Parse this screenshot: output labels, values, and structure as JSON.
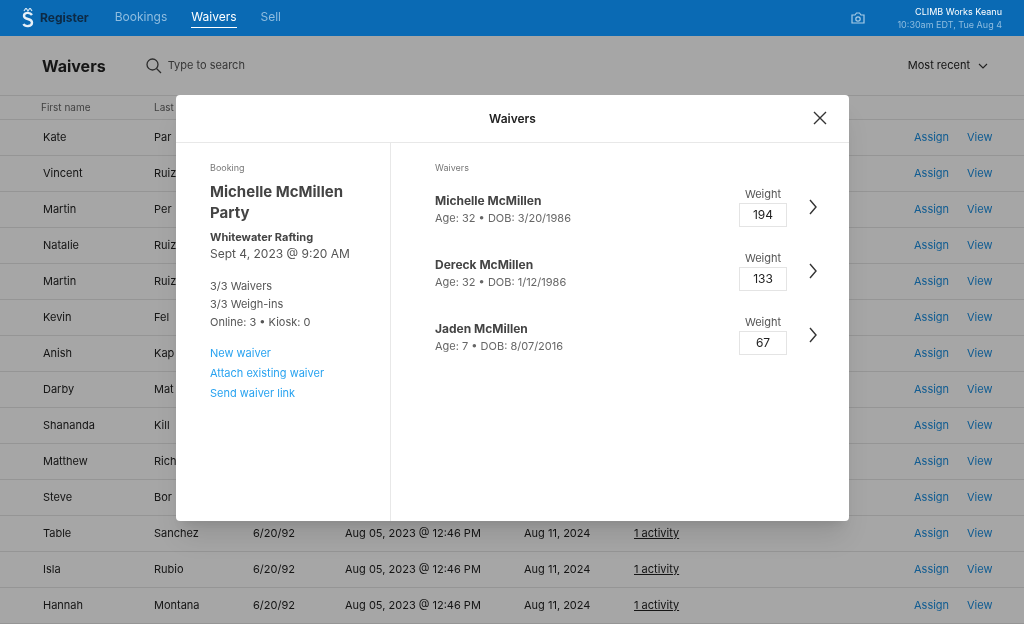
{
  "topbar": {
    "brand": "Register",
    "nav": [
      {
        "label": "Bookings",
        "selected": false
      },
      {
        "label": "Waivers",
        "selected": true
      },
      {
        "label": "Sell",
        "selected": false
      }
    ],
    "account_name": "CLIMB Works Keanu",
    "account_time": "10:30am EDT, Tue Aug 4"
  },
  "page": {
    "title": "Waivers",
    "search_placeholder": "Type to search",
    "sort_label": "Most recent"
  },
  "table": {
    "columns": [
      "First name",
      "Last"
    ],
    "rows": [
      {
        "first": "Kate",
        "last": "Par",
        "actions": [
          "Assign",
          "View"
        ]
      },
      {
        "first": "Vincent",
        "last": "Ruiz",
        "actions": [
          "Assign",
          "View"
        ]
      },
      {
        "first": "Martin",
        "last": "Per",
        "actions": [
          "Assign",
          "View"
        ]
      },
      {
        "first": "Natalie",
        "last": "Ruiz",
        "actions": [
          "Assign",
          "View"
        ]
      },
      {
        "first": "Martin",
        "last": "Ruiz",
        "actions": [
          "Assign",
          "View"
        ]
      },
      {
        "first": "Kevin",
        "last": "Fel",
        "actions": [
          "Assign",
          "View"
        ]
      },
      {
        "first": "Anish",
        "last": "Kap",
        "actions": [
          "Assign",
          "View"
        ]
      },
      {
        "first": "Darby",
        "last": "Mat",
        "actions": [
          "Assign",
          "View"
        ]
      },
      {
        "first": "Shananda",
        "last": "Kill",
        "actions": [
          "Assign",
          "View"
        ]
      },
      {
        "first": "Matthew",
        "last": "Rich",
        "actions": [
          "Assign",
          "View"
        ]
      },
      {
        "first": "Steve",
        "last": "Bor",
        "actions": [
          "Assign",
          "View"
        ]
      },
      {
        "first": "Table",
        "last": "Sanchez",
        "dob": "6/20/92",
        "created": "Aug 05, 2023 @ 12:46 PM",
        "expires": "Aug 11, 2024",
        "activity": "1 activity",
        "actions": [
          "Assign",
          "View"
        ]
      },
      {
        "first": "Isla",
        "last": "Rubio",
        "dob": "6/20/92",
        "created": "Aug 05, 2023 @ 12:46 PM",
        "expires": "Aug 11, 2024",
        "activity": "1 activity",
        "actions": [
          "Assign",
          "View"
        ]
      },
      {
        "first": "Hannah",
        "last": "Montana",
        "dob": "6/20/92",
        "created": "Aug 05, 2023 @ 12:46 PM",
        "expires": "Aug 11, 2024",
        "activity": "1 activity",
        "actions": [
          "Assign",
          "View"
        ]
      }
    ]
  },
  "modal": {
    "title": "Waivers",
    "booking": {
      "heading": "Booking",
      "name": "Michelle McMillen Party",
      "activity": "Whitewater Rafting",
      "datetime": "Sept 4, 2023 @ 9:20 AM",
      "stats": [
        "3/3 Waivers",
        "3/3 Weigh-ins",
        "Online: 3 • Kiosk: 0"
      ],
      "links": [
        "New waiver",
        "Attach existing waiver",
        "Send waiver link"
      ]
    },
    "waivers": {
      "heading": "Waivers",
      "people": [
        {
          "name": "Michelle McMillen",
          "details": "Age: 32 • DOB: 3/20/1986",
          "weight_label": "Weight",
          "weight": "194"
        },
        {
          "name": "Dereck McMillen",
          "details": "Age: 32 • DOB: 1/12/1986",
          "weight_label": "Weight",
          "weight": "133"
        },
        {
          "name": "Jaden McMillen",
          "details": "Age: 7 • DOB: 8/07/2016",
          "weight_label": "Weight",
          "weight": "67"
        }
      ]
    }
  }
}
